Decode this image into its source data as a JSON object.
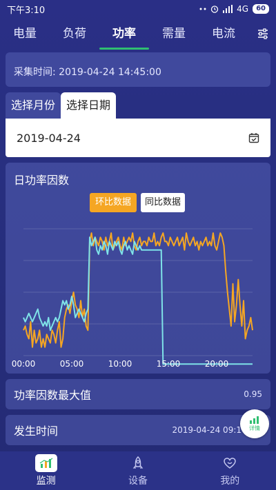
{
  "status_bar": {
    "time": "下午3:10",
    "signal_text": "4G",
    "battery": "60"
  },
  "tabs": [
    {
      "label": "电量",
      "active": false
    },
    {
      "label": "负荷",
      "active": false
    },
    {
      "label": "功率",
      "active": true
    },
    {
      "label": "需量",
      "active": false
    },
    {
      "label": "电流",
      "active": false
    }
  ],
  "collect_time": "采集时间: 2019-04-24 14:45:00",
  "date_select": {
    "month_tab": "选择月份",
    "day_tab": "选择日期",
    "value": "2019-04-24"
  },
  "chart_card": {
    "title": "日功率因数",
    "ring_button": "环比数据",
    "yoy_button": "同比数据"
  },
  "chart_data": {
    "type": "line",
    "x_ticks": [
      "00:00",
      "05:00",
      "10:00",
      "15:00",
      "20:00"
    ],
    "ylim": [
      0.7,
      1.0
    ],
    "series": [
      {
        "color": "#f5a623",
        "values": [
          0.76,
          0.77,
          0.75,
          0.74,
          0.78,
          0.72,
          0.76,
          0.73,
          0.74,
          0.76,
          0.72,
          0.74,
          0.72,
          0.75,
          0.74,
          0.73,
          0.76,
          0.75,
          0.73,
          0.76,
          0.78,
          0.72,
          0.74,
          0.79,
          0.81,
          0.82,
          0.8,
          0.83,
          0.85,
          0.82,
          0.81,
          0.79,
          0.83,
          0.79,
          0.81,
          0.77,
          0.76,
          0.97,
          0.99,
          0.96,
          0.98,
          0.97,
          0.96,
          0.98,
          0.97,
          0.95,
          0.98,
          0.96,
          0.97,
          0.99,
          0.95,
          0.96,
          0.97,
          0.98,
          0.96,
          0.95,
          0.98,
          0.96,
          0.97,
          0.98,
          0.97,
          0.99,
          0.96,
          0.95,
          0.97,
          0.98,
          0.96,
          0.97,
          0.97,
          0.96,
          0.98,
          0.97,
          0.97,
          0.99,
          0.96,
          0.97,
          0.96,
          0.98,
          0.99,
          0.97,
          0.97,
          0.96,
          0.98,
          0.97,
          0.96,
          0.97,
          0.98,
          0.96,
          0.97,
          0.98,
          0.95,
          0.99,
          0.97,
          0.96,
          0.97,
          0.98,
          0.96,
          0.97,
          0.95,
          0.97,
          0.96,
          0.97,
          0.98,
          0.96,
          0.97,
          0.96,
          0.99,
          0.96,
          0.95,
          0.97,
          0.99,
          0.98,
          0.96,
          0.9,
          0.85,
          0.81,
          0.77,
          0.87,
          0.78,
          0.82,
          0.88,
          0.82,
          0.77,
          0.83,
          0.74,
          0.76,
          0.77,
          0.79,
          0.76
        ]
      },
      {
        "color": "#7fe3e8",
        "values": [
          0.79,
          0.78,
          0.79,
          0.8,
          0.79,
          0.78,
          0.79,
          0.8,
          0.81,
          0.79,
          0.78,
          0.77,
          0.78,
          0.77,
          0.79,
          0.76,
          0.77,
          0.78,
          0.79,
          0.78,
          0.79,
          0.81,
          0.83,
          0.82,
          0.83,
          0.81,
          0.82,
          0.84,
          0.82,
          0.79,
          0.8,
          0.81,
          0.8,
          0.79,
          0.78,
          0.8,
          0.81,
          0.98,
          0.96,
          0.97,
          0.98,
          0.95,
          0.94,
          0.96,
          0.95,
          0.97,
          0.96,
          0.94,
          0.97,
          0.96,
          0.95,
          0.97,
          0.96,
          0.97,
          0.95,
          0.94,
          0.96,
          0.97,
          0.95,
          0.96,
          0.95,
          0.94,
          0.97,
          0.96,
          0.95,
          0.96,
          0.95,
          0.95,
          0.95,
          0.95,
          0.95,
          0.95,
          0.95,
          0.95,
          0.95,
          0.95,
          0.95,
          0.95,
          0.68,
          0.68,
          0.68,
          0.68,
          0.68,
          0.68,
          0.68,
          0.68,
          0.68,
          0.68,
          0.68,
          0.68,
          0.68,
          0.68,
          0.68,
          0.68,
          0.68,
          0.68,
          0.68,
          0.68,
          0.68,
          0.68,
          0.68,
          0.68,
          0.68,
          0.68,
          0.68,
          0.68,
          0.68,
          0.68,
          0.68,
          0.68,
          0.68,
          0.68,
          0.68,
          0.68,
          0.68,
          0.68,
          0.68,
          0.68,
          0.68,
          0.68,
          0.68,
          0.68,
          0.68,
          0.68,
          0.68,
          0.68,
          0.68,
          0.68,
          0.68
        ]
      }
    ]
  },
  "max_power_factor": {
    "label": "功率因数最大值",
    "value": "0.95"
  },
  "occur_time": {
    "label": "发生时间",
    "value": "2019-04-24 09:1"
  },
  "detail_badge": {
    "label": "详情"
  },
  "bottom_nav": [
    {
      "label": "监测",
      "active": true
    },
    {
      "label": "设备",
      "active": false
    },
    {
      "label": "我的",
      "active": false
    }
  ]
}
